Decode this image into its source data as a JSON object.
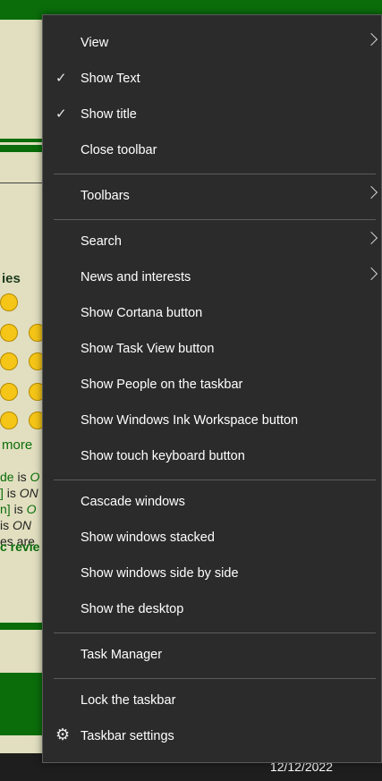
{
  "background": {
    "heading": "ies",
    "more": "more",
    "lines": [
      {
        "pre": "de",
        "mid": " is ",
        "post": "O"
      },
      {
        "pre": "]",
        "mid": " is ",
        "post": "ON"
      },
      {
        "pre": "n]",
        "mid": " is ",
        "post": "O"
      },
      {
        "pre": "is",
        "mid": " ",
        "post": "ON"
      },
      {
        "pre": "es are",
        "mid": "",
        "post": ""
      }
    ],
    "review": "c revie"
  },
  "taskbar": {
    "date": "12/12/2022"
  },
  "menu": {
    "items": [
      {
        "label": "View",
        "submenu": true
      },
      {
        "label": "Show Text",
        "checked": true
      },
      {
        "label": "Show title",
        "checked": true
      },
      {
        "label": "Close toolbar"
      },
      {
        "label": "Toolbars",
        "submenu": true
      },
      {
        "label": "Search",
        "submenu": true
      },
      {
        "label": "News and interests",
        "submenu": true
      },
      {
        "label": "Show Cortana button"
      },
      {
        "label": "Show Task View button"
      },
      {
        "label": "Show People on the taskbar"
      },
      {
        "label": "Show Windows Ink Workspace button"
      },
      {
        "label": "Show touch keyboard button"
      },
      {
        "label": "Cascade windows"
      },
      {
        "label": "Show windows stacked"
      },
      {
        "label": "Show windows side by side"
      },
      {
        "label": "Show the desktop"
      },
      {
        "label": "Task Manager"
      },
      {
        "label": "Lock the taskbar"
      },
      {
        "label": "Taskbar settings",
        "icon": "gear-icon"
      }
    ],
    "check_glyph": "✓",
    "gear_glyph": "⚙"
  }
}
